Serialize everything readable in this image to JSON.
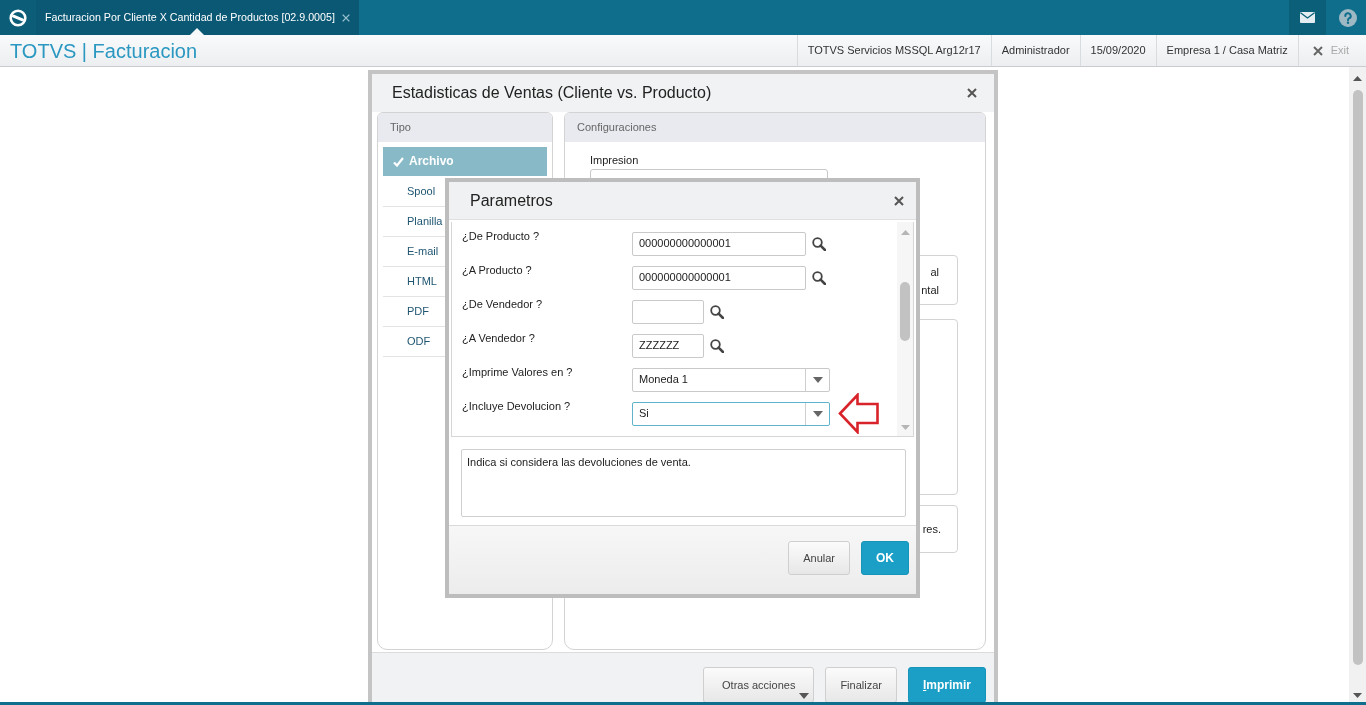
{
  "top_bar": {
    "tab": {
      "title": "Facturacion Por Cliente X Cantidad de Productos [02.9.0005]"
    }
  },
  "header": {
    "app_title": "TOTVS | Facturacion",
    "info": [
      "TOTVS Servicios MSSQL Arg12r17",
      "Administrador",
      "15/09/2020",
      "Empresa 1 / Casa Matriz"
    ],
    "exit": "Exit"
  },
  "main_dialog": {
    "title": "Estadisticas de Ventas (Cliente vs. Producto)",
    "tipo": {
      "heading": "Tipo",
      "items": [
        {
          "label": "Archivo",
          "selected": true
        },
        {
          "label": "Spool",
          "selected": false
        },
        {
          "label": "Planilla",
          "selected": false
        },
        {
          "label": "E-mail",
          "selected": false
        },
        {
          "label": "HTML",
          "selected": false
        },
        {
          "label": "PDF",
          "selected": false
        },
        {
          "label": "ODF",
          "selected": false
        }
      ]
    },
    "configuraciones": {
      "heading": "Configuraciones",
      "impresion_label": "Impresion",
      "box_1_lines": [
        "al",
        "ntal"
      ],
      "box_3_text": "res."
    },
    "buttons": [
      {
        "label": "Otras acciones",
        "kind": "menu",
        "mnemonic": false
      },
      {
        "label": "Finalizar",
        "kind": "default",
        "mnemonic": false
      },
      {
        "label": "Imprimir",
        "kind": "primary",
        "mnemonic": true
      }
    ]
  },
  "parametros": {
    "title": "Parametros",
    "questions": [
      {
        "label": "¿De Producto ?",
        "kind": "longlookup",
        "value": "000000000000001",
        "focused": false
      },
      {
        "label": "¿A Producto ?",
        "kind": "longlookup",
        "value": "000000000000001",
        "focused": false
      },
      {
        "label": "¿De Vendedor ?",
        "kind": "shortlookup",
        "focused": false
      },
      {
        "label": "¿A Vendedor ?",
        "kind": "shortlookup",
        "value": "ZZZZZZ",
        "focused": false
      },
      {
        "label": "¿Imprime Valores en ?",
        "kind": "select",
        "value": "Moneda 1",
        "focused": false
      },
      {
        "label": "¿Incluye Devolucion ?",
        "kind": "select",
        "value": "Si",
        "focused": true
      }
    ],
    "help": "Indica si considera las devoluciones de venta.",
    "buttons": [
      {
        "label": "Anular",
        "kind": "default",
        "mnemonic": false
      },
      {
        "label": "OK",
        "kind": "primary",
        "mnemonic": false
      }
    ]
  }
}
